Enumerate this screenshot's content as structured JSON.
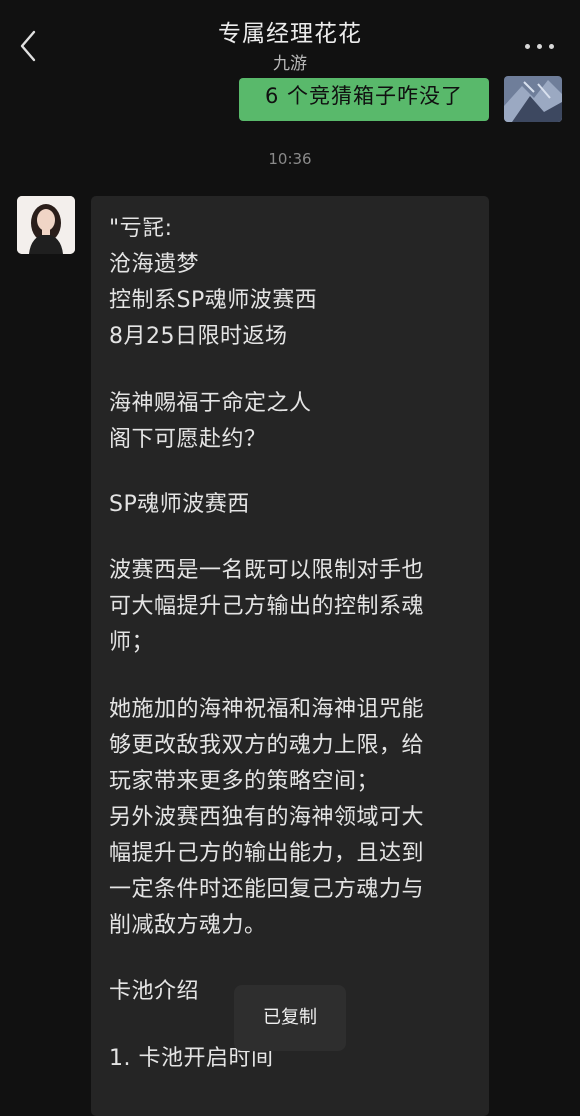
{
  "header": {
    "title": "专属经理花花",
    "subtitle": "九游"
  },
  "messages": {
    "outgoing_text": "6 个竞猜箱子咋没了",
    "timestamp": "10:36",
    "incoming_lines": [
      "\"亏㓃:",
      "沧海遗梦",
      "控制系SP魂师波赛西",
      "8月25日限时返场",
      "",
      "海神赐福于命定之人",
      "阁下可愿赴约？",
      "",
      "SP魂师波赛西",
      "",
      "波赛西是一名既可以限制对手也",
      "可大幅提升己方输出的控制系魂",
      "师；",
      "",
      "她施加的海神祝福和海神诅咒能",
      "够更改敌我双方的魂力上限，给",
      "玩家带来更多的策略空间；",
      "另外波赛西独有的海神领域可大",
      "幅提升己方的输出能力，且达到",
      "一定条件时还能回复己方魂力与",
      "削减敌方魂力。",
      "",
      "卡池介绍",
      "",
      "1. 卡池开启时间"
    ]
  },
  "toast": {
    "text": "已复制"
  }
}
